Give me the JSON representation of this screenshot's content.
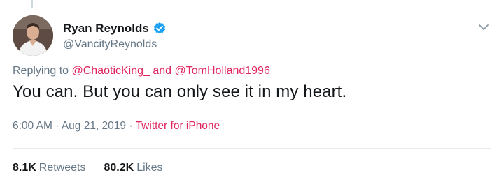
{
  "tweet": {
    "author": {
      "name": "Ryan Reynolds",
      "handle": "@VancityReynolds",
      "verified": true,
      "verified_color": "#1da1f2"
    },
    "reply": {
      "prefix": "Replying to",
      "mention_1": "@ChaoticKing_",
      "conjunction": "and",
      "mention_2": "@TomHolland1996"
    },
    "text": "You can. But you can only see it in my heart.",
    "meta": {
      "time": "6:00 AM",
      "separator": "·",
      "date": "Aug 21, 2019",
      "client": "Twitter for iPhone"
    },
    "stats": {
      "retweets_count": "8.1K",
      "retweets_label": "Retweets",
      "likes_count": "80.2K",
      "likes_label": "Likes"
    }
  },
  "icons": {
    "verified": "verified-badge-icon",
    "menu": "chevron-down-icon"
  },
  "colors": {
    "link": "#e0245e",
    "secondary_text": "#657786",
    "primary_text": "#14171a"
  }
}
